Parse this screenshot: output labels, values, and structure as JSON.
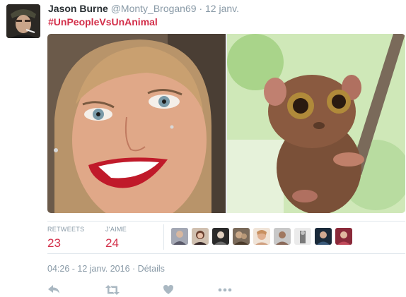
{
  "tweet": {
    "author_name": "Jason Burne",
    "author_handle": "@Monty_Brogan69",
    "separator": "·",
    "time_short": "12 janv.",
    "hashtag": "#UnPeopleVsUnAnimal",
    "media": [
      {
        "icon": "woman-portrait-photo"
      },
      {
        "icon": "tarsier-photo"
      }
    ]
  },
  "stats": {
    "retweets_label": "RETWEETS",
    "retweets_count": "23",
    "likes_label": "J'AIME",
    "likes_count": "24"
  },
  "likers_count_shown": 9,
  "meta": {
    "datetime": "04:26 - 12 janv. 2016",
    "separator": "·",
    "details_label": "Détails"
  },
  "actions": [
    {
      "icon": "reply-icon"
    },
    {
      "icon": "retweet-icon"
    },
    {
      "icon": "like-icon"
    },
    {
      "icon": "more-icon"
    }
  ],
  "colors": {
    "accent": "#d32f4a",
    "muted": "#8899a6",
    "text": "#292f33",
    "icon": "#aab8c2",
    "border": "#e1e8ed"
  }
}
